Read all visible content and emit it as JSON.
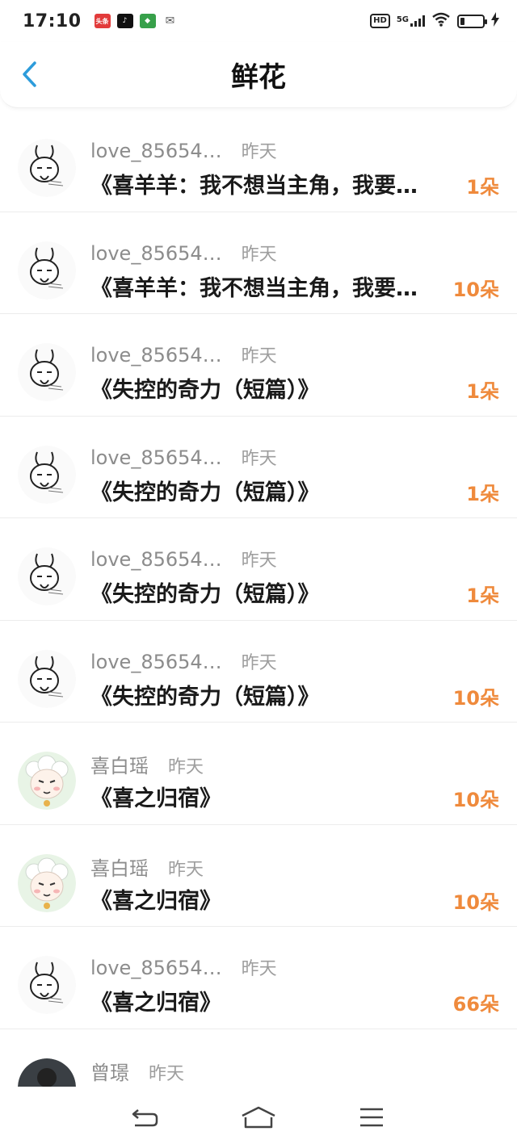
{
  "status_bar": {
    "time": "17:10",
    "app_badges": [
      {
        "text": "头条",
        "color": "#e23b3b"
      },
      {
        "text": "♪",
        "color": "#111111"
      },
      {
        "text": "◆",
        "color": "#37a04a"
      },
      {
        "text": "✉",
        "color": "#555555"
      }
    ],
    "hd_label": "HD",
    "signal_label": "5G",
    "battery_level": 0.15
  },
  "header": {
    "title": "鲜花"
  },
  "colors": {
    "accent_blue": "#2d9cdb",
    "count_orange": "#ef8a3c",
    "muted_text": "#8c8c8c"
  },
  "rows": [
    {
      "name": "love_85654…",
      "time": "昨天",
      "title": "《喜羊羊：我不想当主角，我要…",
      "count": "1朵",
      "avatar": "rabbit"
    },
    {
      "name": "love_85654…",
      "time": "昨天",
      "title": "《喜羊羊：我不想当主角，我要…",
      "count": "10朵",
      "avatar": "rabbit"
    },
    {
      "name": "love_85654…",
      "time": "昨天",
      "title": "《失控的奇力（短篇）》",
      "count": "1朵",
      "avatar": "rabbit"
    },
    {
      "name": "love_85654…",
      "time": "昨天",
      "title": "《失控的奇力（短篇）》",
      "count": "1朵",
      "avatar": "rabbit"
    },
    {
      "name": "love_85654…",
      "time": "昨天",
      "title": "《失控的奇力（短篇）》",
      "count": "1朵",
      "avatar": "rabbit"
    },
    {
      "name": "love_85654…",
      "time": "昨天",
      "title": "《失控的奇力（短篇）》",
      "count": "10朵",
      "avatar": "rabbit"
    },
    {
      "name": "喜白瑶",
      "time": "昨天",
      "title": "《喜之归宿》",
      "count": "10朵",
      "avatar": "sheep"
    },
    {
      "name": "喜白瑶",
      "time": "昨天",
      "title": "《喜之归宿》",
      "count": "10朵",
      "avatar": "sheep"
    },
    {
      "name": "love_85654…",
      "time": "昨天",
      "title": "《喜之归宿》",
      "count": "66朵",
      "avatar": "rabbit"
    },
    {
      "name": "曾璟",
      "time": "昨天",
      "title": "《…》",
      "count": "",
      "avatar": "photo"
    }
  ],
  "nav": {
    "back": "back-icon",
    "home": "home-icon",
    "menu": "menu-icon"
  }
}
